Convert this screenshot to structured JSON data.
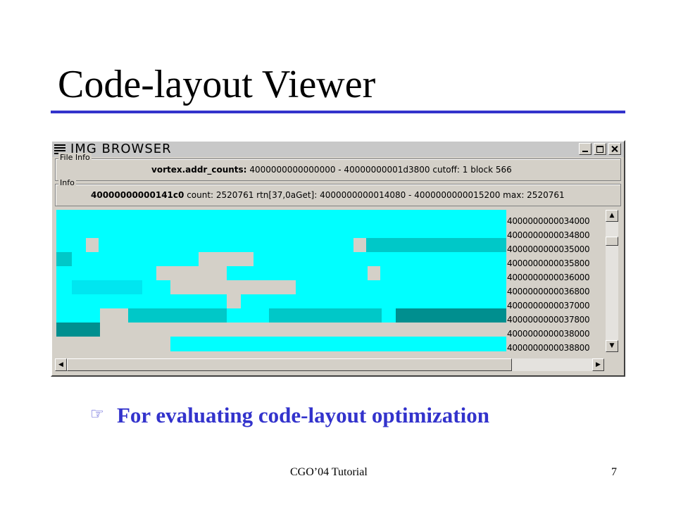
{
  "slide": {
    "title": "Code-layout Viewer",
    "bullet_text": "For evaluating code-layout optimization",
    "bullet_icon": "pointing-hand-icon",
    "footer_center": "CGO’04 Tutorial",
    "page_number": "7",
    "accent_color": "#3333cc"
  },
  "window": {
    "title": "IMG BROWSER",
    "file_info": {
      "label": "File Info",
      "filename": "vortex.addr_counts:",
      "details": "4000000000000000 - 40000000001d3800  cutoff: 1 block 566"
    },
    "info": {
      "label": "Info",
      "address": "40000000000141c0",
      "details": "count: 2520761  rtn[37,0aGet]: 4000000000014080 - 4000000000015200  max: 2520761"
    },
    "addresses": [
      "4000000000034000",
      "4000000000034800",
      "4000000000035000",
      "4000000000035800",
      "4000000000036000",
      "4000000000036800",
      "4000000000037000",
      "4000000000037800",
      "4000000000038000",
      "4000000000038800"
    ],
    "colors": {
      "canvas": "#00ffff",
      "light_block": "#d4d0c8",
      "mid_block": "#00c8c8",
      "dark_block": "#008f8f"
    }
  }
}
